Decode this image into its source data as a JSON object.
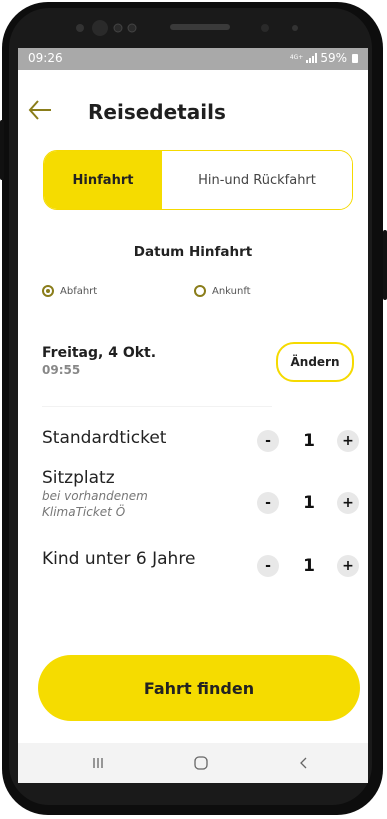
{
  "status_bar": {
    "time": "09:26",
    "network": "4G+",
    "battery": "59%"
  },
  "header": {
    "title": "Reisedetails",
    "back_icon": "arrow-left-icon"
  },
  "trip_tabs": [
    {
      "label": "Hinfahrt",
      "selected": true
    },
    {
      "label": "Hin-und Rückfahrt",
      "selected": false
    }
  ],
  "date_section": {
    "heading": "Datum Hinfahrt",
    "options": [
      {
        "label": "Abfahrt",
        "selected": true
      },
      {
        "label": "Ankunft",
        "selected": false
      }
    ],
    "date": "Freitag, 4 Okt.",
    "time": "09:55",
    "change_label": "Ändern"
  },
  "passengers": [
    {
      "label": "Standardticket",
      "sublabel": "",
      "count": "1",
      "minus": "-",
      "plus": "+"
    },
    {
      "label": "Sitzplatz",
      "sublabel": "bei vorhandenem KlimaTicket Ö",
      "count": "1",
      "minus": "-",
      "plus": "+"
    },
    {
      "label": "Kind unter 6 Jahre",
      "sublabel": "",
      "count": "1",
      "minus": "-",
      "plus": "+"
    }
  ],
  "find_button": {
    "label": "Fahrt finden"
  },
  "colors": {
    "accent": "#f5dc00",
    "radio": "#8a7d1a",
    "status_bar": "#a9a9a9"
  },
  "nav_bar": {
    "icons": [
      "recent-apps-icon",
      "home-icon",
      "back-icon"
    ]
  }
}
